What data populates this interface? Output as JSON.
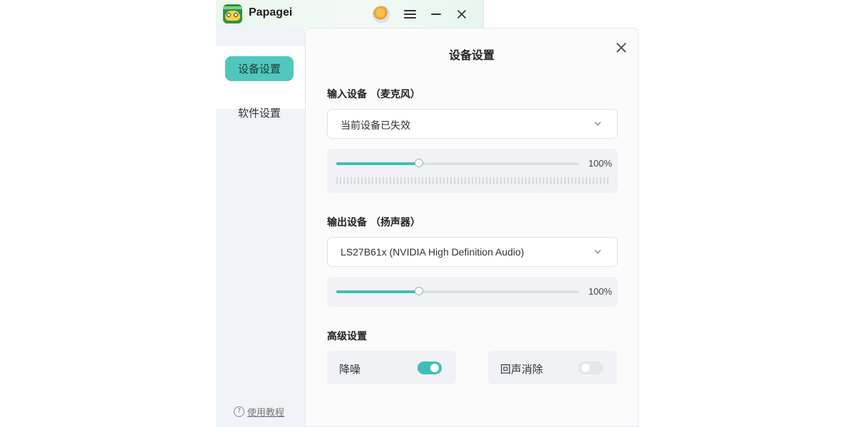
{
  "app": {
    "name": "Papagei"
  },
  "sidebar": {
    "items": [
      {
        "label": "设备设置",
        "active": true
      },
      {
        "label": "软件设置",
        "active": false
      }
    ],
    "tutorial_label": "使用教程"
  },
  "panel": {
    "title": "设备设置",
    "input": {
      "title": "输入设备 （麦克风）",
      "device": "当前设备已失效",
      "volume_label": "100%",
      "volume_fraction": 0.34
    },
    "output": {
      "title": "输出设备 （扬声器）",
      "device": "LS27B61x (NVIDIA High Definition Audio)",
      "volume_label": "100%",
      "volume_fraction": 0.34
    },
    "advanced": {
      "title": "高级设置",
      "noise_reduction": {
        "label": "降噪",
        "enabled": true
      },
      "echo_cancellation": {
        "label": "回声消除",
        "enabled": false
      }
    }
  },
  "colors": {
    "accent": "#3fbfb3",
    "sidebar_active": "#4fc7bd",
    "sidebar_bg": "#f0f3f7"
  },
  "icons": [
    "app-logo-icon",
    "avatar-icon",
    "menu-icon",
    "minimize-icon",
    "close-icon",
    "chevron-down-icon",
    "help-circle-icon"
  ]
}
